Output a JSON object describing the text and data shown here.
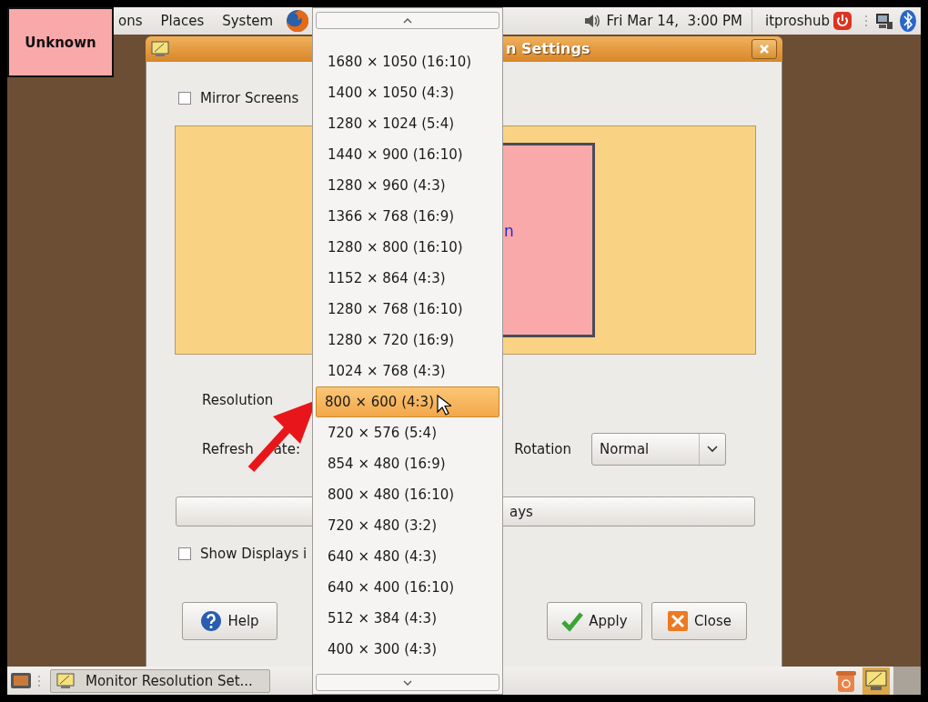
{
  "top_panel": {
    "menus": [
      "ons",
      "Places",
      "System"
    ],
    "clock": "Fri Mar 14,  3:00 PM",
    "user": "itproshub"
  },
  "drag_label": {
    "text": "Unknown"
  },
  "dialog": {
    "title": "n Settings",
    "mirror_screens": {
      "label": "Mirror Screens",
      "checked": false
    },
    "preview": {
      "monitor_label": "n"
    },
    "resolution_label": "Resolution",
    "refresh_rate_label": [
      "Refresh",
      "ate:"
    ],
    "rotation": {
      "label": "Rotation",
      "value": "Normal"
    },
    "detect_button": "ays",
    "show_displays": {
      "label": "Show Displays i",
      "checked": false
    },
    "buttons": [
      {
        "label": "Help",
        "kind": "help"
      },
      {
        "label": "Apply",
        "kind": "apply"
      },
      {
        "label": "Close",
        "kind": "close"
      }
    ]
  },
  "resolution_list": {
    "items": [
      {
        "label": "1680 × 1050 (16:10)",
        "selected": false
      },
      {
        "label": "1400 × 1050 (4:3)",
        "selected": false
      },
      {
        "label": "1280 × 1024 (5:4)",
        "selected": false
      },
      {
        "label": "1440 × 900 (16:10)",
        "selected": false
      },
      {
        "label": "1280 × 960 (4:3)",
        "selected": false
      },
      {
        "label": "1366 × 768 (16:9)",
        "selected": false
      },
      {
        "label": "1280 × 800 (16:10)",
        "selected": false
      },
      {
        "label": "1152 × 864 (4:3)",
        "selected": false
      },
      {
        "label": "1280 × 768 (16:10)",
        "selected": false
      },
      {
        "label": "1280 × 720 (16:9)",
        "selected": false
      },
      {
        "label": "1024 × 768 (4:3)",
        "selected": false
      },
      {
        "label": "800 × 600 (4:3)",
        "selected": true
      },
      {
        "label": "720 × 576 (5:4)",
        "selected": false
      },
      {
        "label": "854 × 480 (16:9)",
        "selected": false
      },
      {
        "label": "800 × 480 (16:10)",
        "selected": false
      },
      {
        "label": "720 × 480 (3:2)",
        "selected": false
      },
      {
        "label": "640 × 480 (4:3)",
        "selected": false
      },
      {
        "label": "640 × 400 (16:10)",
        "selected": false
      },
      {
        "label": "512 × 384 (4:3)",
        "selected": false
      },
      {
        "label": "400 × 300 (4:3)",
        "selected": false
      }
    ]
  },
  "taskbar": {
    "task": "Monitor Resolution Set..."
  }
}
